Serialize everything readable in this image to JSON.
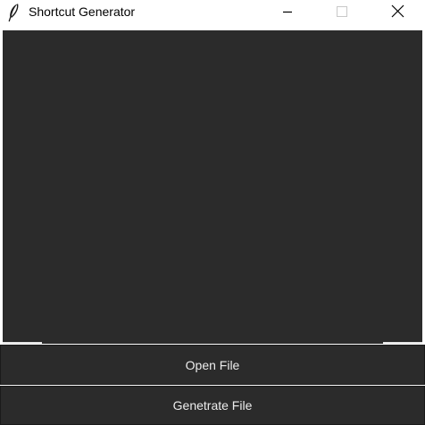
{
  "window": {
    "title": "Shortcut Generator",
    "app_icon": "feather-icon",
    "controls": {
      "minimize_icon": "minimize-icon",
      "maximize_icon": "maximize-icon",
      "close_icon": "close-icon"
    }
  },
  "main": {
    "canvas_color": "#2b2b2b"
  },
  "buttons": {
    "open_file_label": "Open File",
    "generate_file_label": "Genetrate File"
  }
}
